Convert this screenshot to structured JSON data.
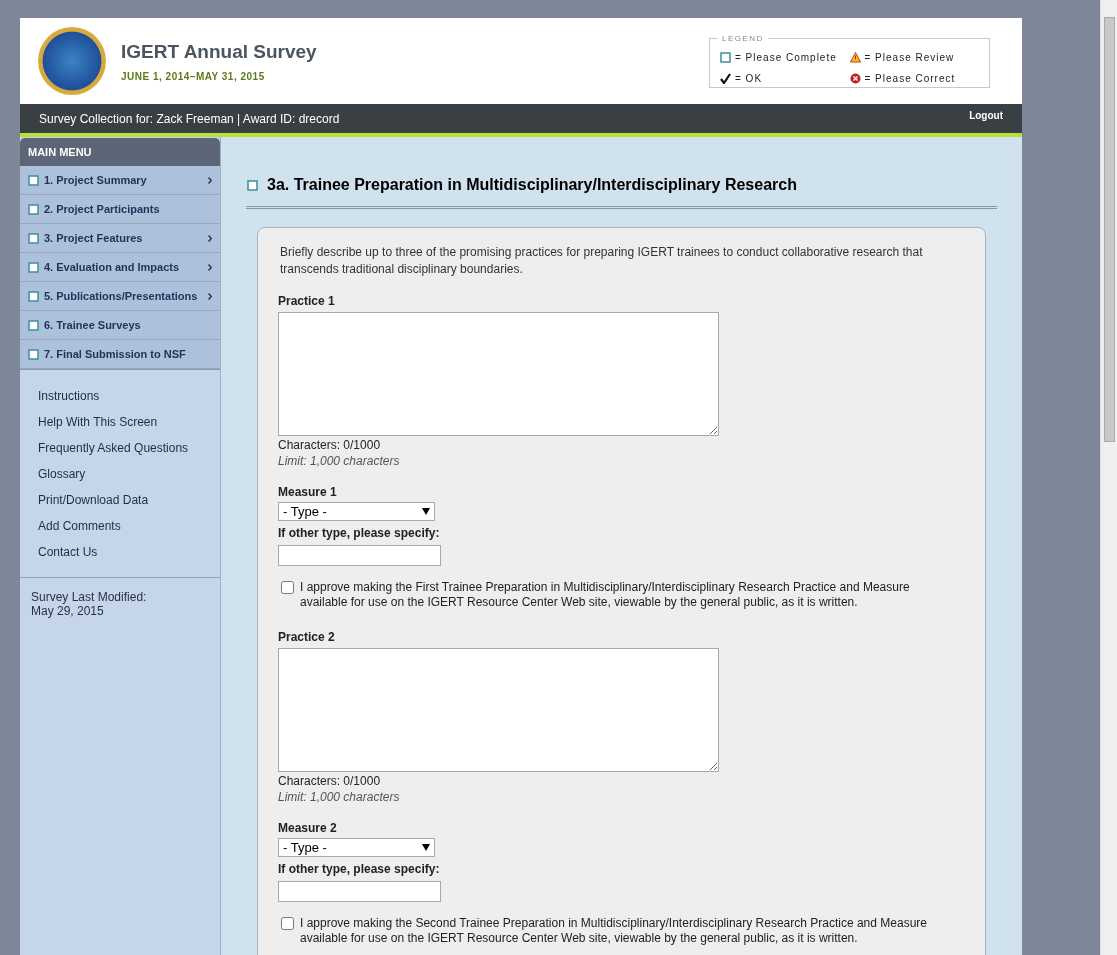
{
  "header": {
    "title": "IGERT Annual Survey",
    "dates": "JUNE 1, 2014–MAY 31, 2015"
  },
  "legend": {
    "title": "LEGEND",
    "items": [
      {
        "kind": "complete",
        "label": "= Please Complete"
      },
      {
        "kind": "review",
        "label": "= Please Review"
      },
      {
        "kind": "ok",
        "label": "= OK"
      },
      {
        "kind": "correct",
        "label": "= Please Correct"
      }
    ]
  },
  "user_bar": {
    "text": "Survey Collection for: Zack Freeman | Award ID: drecord",
    "logout": "Logout"
  },
  "main_menu": {
    "title": "MAIN MENU",
    "items": [
      {
        "label": "1. Project Summary",
        "completed": false,
        "has_submenu": true
      },
      {
        "label": "2. Project Participants",
        "completed": false,
        "has_submenu": false
      },
      {
        "label": "3. Project Features",
        "completed": false,
        "has_submenu": true
      },
      {
        "label": "4. Evaluation and Impacts",
        "completed": false,
        "has_submenu": true
      },
      {
        "label": "5. Publications/Presentations",
        "completed": false,
        "has_submenu": true
      },
      {
        "label": "6. Trainee Surveys",
        "completed": false,
        "has_submenu": false
      },
      {
        "label": "7. Final Submission to NSF",
        "completed": false,
        "has_submenu": false
      }
    ]
  },
  "links": [
    "Instructions",
    "Help With This Screen",
    "Frequently Asked Questions",
    "Glossary",
    "Print/Download Data",
    "Add Comments",
    "Contact Us"
  ],
  "last_modified": {
    "label": "Survey Last Modified:",
    "date": "May 29, 2015"
  },
  "section": {
    "completed": false,
    "title": "3a. Trainee Preparation in Multidisciplinary/Interdisciplinary Research",
    "intro": "Briefly describe up to three of the promising practices for preparing IGERT trainees to conduct collaborative research that transcends traditional disciplinary boundaries.",
    "practices": [
      {
        "label": "Practice 1",
        "characters": "Characters: 0/1000",
        "limit": "Limit: 1,000 characters",
        "measure_label": "Measure 1",
        "measure_value": "- Type -",
        "specify_label": "If other type, please specify:",
        "approve_checked": false,
        "approve_text": "I approve making the First Trainee Preparation in Multidisciplinary/Interdisciplinary Research Practice and Measure available for use on the IGERT Resource Center Web site, viewable by the general public, as it is written."
      },
      {
        "label": "Practice 2",
        "characters": "Characters: 0/1000",
        "limit": "Limit: 1,000 characters",
        "measure_label": "Measure 2",
        "measure_value": "- Type -",
        "specify_label": "If other type, please specify:",
        "approve_checked": false,
        "approve_text": "I approve making the Second Trainee Preparation in Multidisciplinary/Interdisciplinary Research Practice and Measure available for use on the IGERT Resource Center Web site, viewable by the general public, as it is written."
      }
    ]
  }
}
